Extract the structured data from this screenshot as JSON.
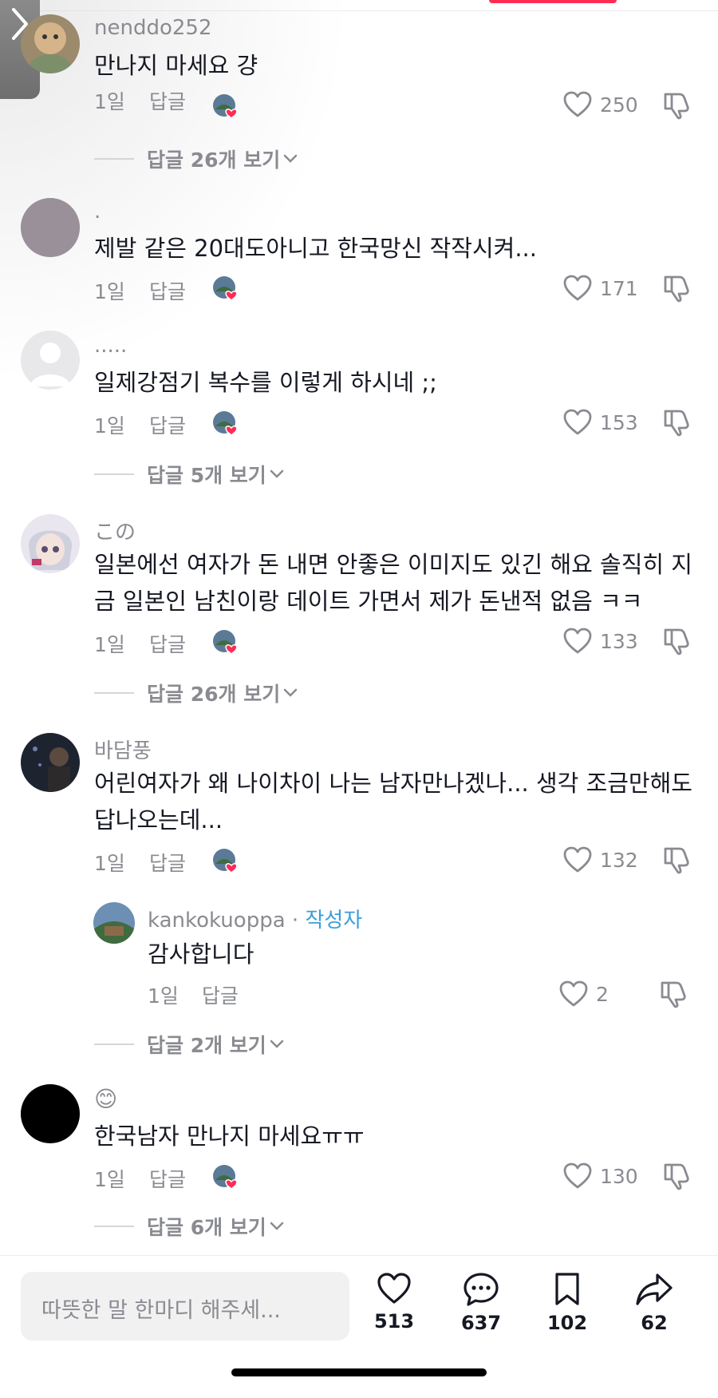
{
  "colors": {
    "accent": "#fe2c55",
    "creator_badge": "#3b9fd8",
    "muted": "#8a8b91"
  },
  "comments": [
    {
      "username": "nenddo252",
      "text": "만나지 마세요 걍",
      "time": "1일",
      "reply_label": "답글",
      "likes": "250",
      "view_replies": "답글 26개 보기"
    },
    {
      "username": ".",
      "text": "제발 같은 20대도아니고 한국망신 작작시켜...",
      "time": "1일",
      "reply_label": "답글",
      "likes": "171"
    },
    {
      "username": ".....",
      "text": "일제강점기 복수를 이렇게 하시네 ;;",
      "time": "1일",
      "reply_label": "답글",
      "likes": "153",
      "view_replies": "답글 5개 보기"
    },
    {
      "username": "この",
      "text": "일본에선 여자가 돈 내면 안좋은 이미지도 있긴 해요 솔직히 지금 일본인 남친이랑 데이트 가면서 제가 돈낸적 없음 ㅋㅋ",
      "time": "1일",
      "reply_label": "답글",
      "likes": "133",
      "view_replies": "답글 26개 보기"
    },
    {
      "username": "바담풍",
      "text": "어린여자가 왜 나이차이 나는 남자만나겠나... 생각 조금만해도 답나오는데...",
      "time": "1일",
      "reply_label": "답글",
      "likes": "132",
      "view_replies": "답글 2개 보기",
      "reply": {
        "username": "kankokuoppa",
        "separator": "·",
        "creator_label": "작성자",
        "text": "감사합니다",
        "time": "1일",
        "reply_label": "답글",
        "likes": "2"
      }
    },
    {
      "username": "😊",
      "text": "한국남자 만나지 마세요ㅠㅠ",
      "time": "1일",
      "reply_label": "답글",
      "likes": "130",
      "view_replies": "답글 6개 보기"
    }
  ],
  "bottom_bar": {
    "placeholder": "따뜻한 말 한마디 해주세...",
    "likes": "513",
    "comments": "637",
    "saves": "102",
    "shares": "62"
  },
  "icons": [
    "back-arrow-icon",
    "heart-icon",
    "dislike-icon",
    "chevron-down-icon",
    "comment-icon",
    "bookmark-icon",
    "share-icon"
  ]
}
